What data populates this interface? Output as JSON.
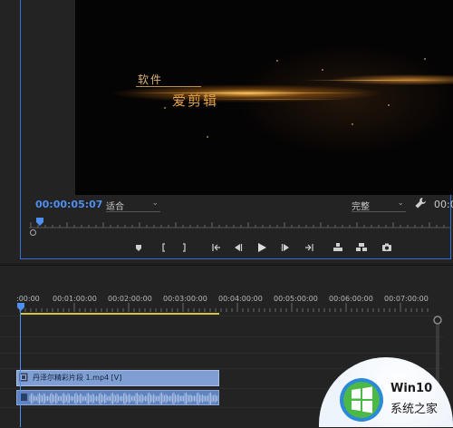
{
  "preview": {
    "title_small": "软件",
    "title_big": "爱剪辑"
  },
  "monitor": {
    "timecode": "00:00:05:07",
    "fit_label": "适合",
    "quality_label": "完整",
    "right_timecode": "00:0"
  },
  "timeline": {
    "ruler_labels": [
      ":00:00",
      "00:01:00:00",
      "00:02:00:00",
      "00:03:00:00",
      "00:04:00:00",
      "00:05:00:00",
      "00:06:00:00",
      "00:07:00:00"
    ],
    "video_clip_label": "丹泽尔精彩片段 1.mp4 [V]",
    "work_area_end_fraction": 0.5
  },
  "watermark": {
    "title": "Win10",
    "subtitle": "系统之家"
  },
  "colors": {
    "accent": "#4f8ff0",
    "work_bar": "#d6c43a",
    "video_clip": "#7f9fd3",
    "audio_clip": "#5f83bf"
  }
}
